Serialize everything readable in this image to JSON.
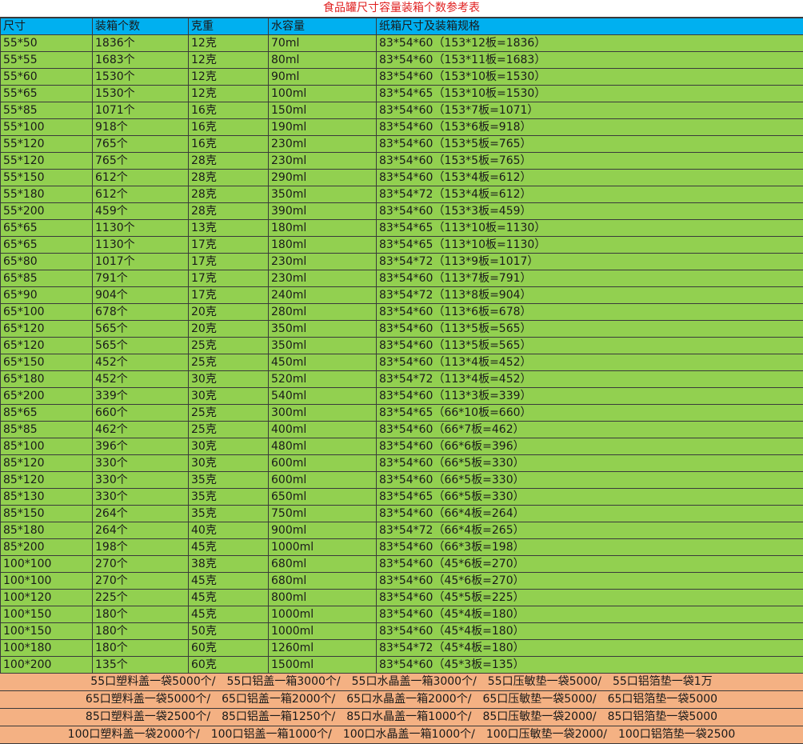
{
  "title": "食品罐尺寸容量装箱个数参考表",
  "header": [
    "尺寸",
    "装箱个数",
    "克重",
    "水容量",
    "纸箱尺寸及装箱规格"
  ],
  "rows": [
    [
      "55*50",
      "1836个",
      "12克",
      "70ml",
      "83*54*60（153*12板=1836）"
    ],
    [
      "55*55",
      "1683个",
      "12克",
      "80ml",
      "83*54*60（153*11板=1683）"
    ],
    [
      "55*60",
      "1530个",
      "12克",
      "90ml",
      "83*54*60（153*10板=1530）"
    ],
    [
      "55*65",
      "1530个",
      "12克",
      "100ml",
      "83*54*65（153*10板=1530）"
    ],
    [
      "55*85",
      "1071个",
      "16克",
      "150ml",
      "83*54*60（153*7板=1071）"
    ],
    [
      "55*100",
      "918个",
      "16克",
      "190ml",
      "83*54*60（153*6板=918）"
    ],
    [
      "55*120",
      "765个",
      "16克",
      "230ml",
      "83*54*60（153*5板=765）"
    ],
    [
      "55*120",
      "765个",
      "28克",
      "230ml",
      "83*54*60（153*5板=765）"
    ],
    [
      "55*150",
      "612个",
      "28克",
      "290ml",
      "83*54*60（153*4板=612）"
    ],
    [
      "55*180",
      "612个",
      "28克",
      "350ml",
      "83*54*72（153*4板=612）"
    ],
    [
      "55*200",
      "459个",
      "28克",
      "390ml",
      "83*54*60（153*3板=459）"
    ],
    [
      "65*65",
      "1130个",
      "13克",
      "180ml",
      "83*54*65（113*10板=1130）"
    ],
    [
      "65*65",
      "1130个",
      "17克",
      "180ml",
      "83*54*65（113*10板=1130）"
    ],
    [
      "65*80",
      "1017个",
      "17克",
      "230ml",
      "83*54*72（113*9板=1017）"
    ],
    [
      "65*85",
      "791个",
      "17克",
      "230ml",
      "83*54*60（113*7板=791）"
    ],
    [
      "65*90",
      "904个",
      "17克",
      "240ml",
      "83*54*72（113*8板=904）"
    ],
    [
      "65*100",
      "678个",
      "20克",
      "280ml",
      "83*54*60（113*6板=678）"
    ],
    [
      "65*120",
      "565个",
      "20克",
      "350ml",
      "83*54*60（113*5板=565）"
    ],
    [
      "65*120",
      "565个",
      "25克",
      "350ml",
      "83*54*60（113*5板=565）"
    ],
    [
      "65*150",
      "452个",
      "25克",
      "450ml",
      "83*54*60（113*4板=452）"
    ],
    [
      "65*180",
      "452个",
      "30克",
      "520ml",
      "83*54*72（113*4板=452）"
    ],
    [
      "65*200",
      "339个",
      "30克",
      "540ml",
      "83*54*60（113*3板=339）"
    ],
    [
      "85*65",
      "660个",
      "25克",
      "300ml",
      "83*54*65（66*10板=660）"
    ],
    [
      "85*85",
      "462个",
      "25克",
      "400ml",
      "83*54*60（66*7板=462）"
    ],
    [
      "85*100",
      "396个",
      "30克",
      "480ml",
      "83*54*60（66*6板=396）"
    ],
    [
      "85*120",
      "330个",
      "30克",
      "600ml",
      "83*54*60（66*5板=330）"
    ],
    [
      "85*120",
      "330个",
      "35克",
      "600ml",
      "83*54*60（66*5板=330）"
    ],
    [
      "85*130",
      "330个",
      "35克",
      "650ml",
      "83*54*65（66*5板=330）"
    ],
    [
      "85*150",
      "264个",
      "35克",
      "750ml",
      "83*54*60（66*4板=264）"
    ],
    [
      "85*180",
      "264个",
      "40克",
      "900ml",
      "83*54*72（66*4板=265）"
    ],
    [
      "85*200",
      "198个",
      "45克",
      "1000ml",
      "83*54*60（66*3板=198）"
    ],
    [
      "100*100",
      "270个",
      "38克",
      "680ml",
      "83*54*60（45*6板=270）"
    ],
    [
      "100*100",
      "270个",
      "45克",
      "680ml",
      "83*54*60（45*6板=270）"
    ],
    [
      "100*120",
      "225个",
      "45克",
      "800ml",
      "83*54*60（45*5板=225）"
    ],
    [
      "100*150",
      "180个",
      "45克",
      "1000ml",
      "83*54*60（45*4板=180）"
    ],
    [
      "100*150",
      "180个",
      "50克",
      "1000ml",
      "83*54*60（45*4板=180）"
    ],
    [
      "100*180",
      "180个",
      "60克",
      "1260ml",
      "83*54*72（45*4板=180）"
    ],
    [
      "100*200",
      "135个",
      "60克",
      "1500ml",
      "83*54*60（45*3板=135）"
    ]
  ],
  "footer": [
    [
      "55口塑料盖一袋5000个/",
      "55口铝盖一箱3000个/",
      "55口水晶盖一箱3000个/",
      "55口压敏垫一袋5000/",
      "55口铝箔垫一袋1万"
    ],
    [
      "65口塑料盖一袋5000个/",
      "65口铝盖一箱2000个/",
      "65口水晶盖一箱2000个/",
      "65口压敏垫一袋5000/",
      "65口铝箔垫一袋5000"
    ],
    [
      "85口塑料盖一袋2500个/",
      "85口铝盖一箱1250个/",
      "85口水晶盖一箱1000个/",
      "85口压敏垫一袋2000/",
      "85口铝箔垫一袋5000"
    ],
    [
      "100口塑料盖一袋2000个/",
      "100口铝盖一箱1000个/",
      "100口水晶盖一箱1000个/",
      "100口压敏垫一袋2000/",
      "100口铝箔垫一袋2500"
    ]
  ],
  "colors": {
    "title_text": "#e02020",
    "header_bg": "#00b0f0",
    "row_bg": "#92d050",
    "footer_bg": "#f4b183"
  }
}
